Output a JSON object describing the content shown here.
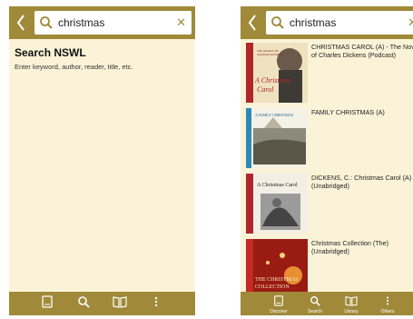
{
  "left_screen": {
    "search": {
      "query": "christmas"
    },
    "title": "Search NSWL",
    "hint": "Enter keyword, author, reader, title, etc."
  },
  "right_screen": {
    "search": {
      "query": "christmas"
    },
    "results": [
      {
        "title": "CHRISTMAS CAROL (A) - The Novels of Charles Dickens (Podcast)",
        "cover_text": [
          "A Christmas",
          "Carol"
        ]
      },
      {
        "title": "FAMILY CHRISTMAS (A)",
        "cover_text": [
          "A FAMILY CHRISTMAS"
        ]
      },
      {
        "title": "DICKENS, C.: Christmas Carol (A) (Unabridged)",
        "cover_text": [
          "A Christmas Carol"
        ]
      },
      {
        "title": "Christmas Collection (The) (Unabridged)",
        "cover_text": [
          "THE CHRISTMAS",
          "COLLECTION"
        ]
      }
    ],
    "tabs": [
      {
        "label": "Discover",
        "icon": "book-icon"
      },
      {
        "label": "Search",
        "icon": "search-icon"
      },
      {
        "label": "Library",
        "icon": "open-book-icon"
      },
      {
        "label": "Others",
        "icon": "more-icon"
      }
    ]
  },
  "colors": {
    "header": "#a08a3a",
    "background": "#fbf3d8",
    "accent": "#a08a3a"
  }
}
